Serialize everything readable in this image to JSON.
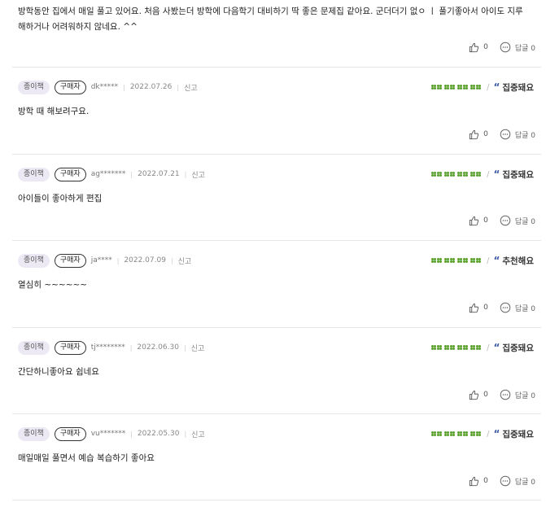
{
  "reviews": [
    {
      "content": "방학동안 집에서 매일 풀고 있어요. 처음 사봤는더 방학에 다음학기 대비하기 딱 좋은 문제집 같아요. 군더더기 없ㅇ ㅣ 풀기좋아서 아이도 지루해하거나 어려워하지 않네요. ^^",
      "content_line1": "방학동안 집에서 매일 풀고 있어요. 처음 사봤는더 방학에 다음학기 대비하기 딱 좋은 문제집 같아요. 군더더기 없ㅇ ㅣ 풀기좋아서 아이도 지루",
      "content_line2": "해하거나 어려워하지 않네요. ^^",
      "likes": "0",
      "reply_label": "답글 0"
    },
    {
      "type_badge": "종이책",
      "buyer_badge": "구매자",
      "user": "dk*****",
      "date": "2022.07.26",
      "report": "신고",
      "rating_clovers": 4,
      "tag": "집중돼요",
      "content": "방학 때 해보려구요.",
      "likes": "0",
      "reply_label": "답글 0"
    },
    {
      "type_badge": "종이책",
      "buyer_badge": "구매자",
      "user": "ag*******",
      "date": "2022.07.21",
      "report": "신고",
      "rating_clovers": 4,
      "tag": "집중돼요",
      "content": "아이들이 좋아하게 편집",
      "likes": "0",
      "reply_label": "답글 0"
    },
    {
      "type_badge": "종이책",
      "buyer_badge": "구매자",
      "user": "ja****",
      "date": "2022.07.09",
      "report": "신고",
      "rating_clovers": 4,
      "tag": "추천해요",
      "content": "열심히 ~~~~~~",
      "likes": "0",
      "reply_label": "답글 0"
    },
    {
      "type_badge": "종이책",
      "buyer_badge": "구매자",
      "user": "tj********",
      "date": "2022.06.30",
      "report": "신고",
      "rating_clovers": 4,
      "tag": "집중돼요",
      "content": "간단하니좋아요 쉽네요",
      "likes": "0",
      "reply_label": "답글 0"
    },
    {
      "type_badge": "종이책",
      "buyer_badge": "구매자",
      "user": "vu*******",
      "date": "2022.05.30",
      "report": "신고",
      "rating_clovers": 4,
      "tag": "집중돼요",
      "content": "매일매일 풀면서 예습 복습하기 좋아요",
      "likes": "0",
      "reply_label": "답글 0"
    }
  ],
  "colors": {
    "clover": "#5aa02c",
    "quote": "#3a5aa8",
    "type_badge_bg": "#ece9f4",
    "divider": "#e6e6e6"
  },
  "icons": {
    "like": "thumbs-up-icon",
    "reply": "speech-bubble-icon",
    "rating": "clover-icon",
    "tag_quote": "quote-icon"
  }
}
